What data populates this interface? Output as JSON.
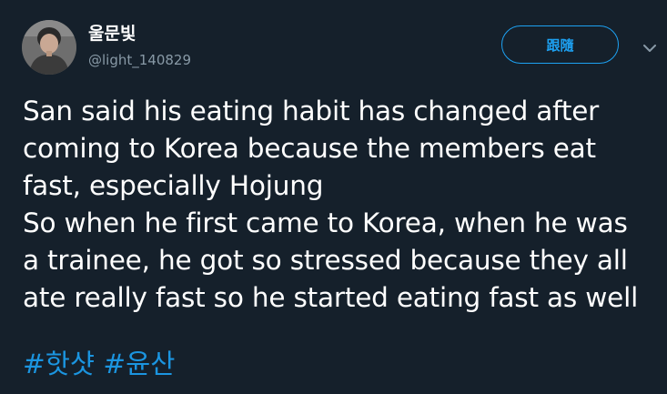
{
  "header": {
    "display_name": "울문빛",
    "handle": "@light_140829",
    "follow_label": "跟隨"
  },
  "tweet": {
    "lines": [
      "San said his eating habit has changed after",
      "coming to Korea because the members eat",
      "fast, especially Hojung",
      "So when he first came to Korea, when he was",
      "a trainee, he got so stressed because they all",
      "ate really fast so he started eating fast as well"
    ],
    "hashtags": [
      "#핫샷",
      "#윤산"
    ]
  },
  "icons": {
    "menu": "chevron-down-icon",
    "avatar": "user-photo"
  },
  "colors": {
    "background": "#15202b",
    "accent": "#1da1f2",
    "hashtag": "#1b95e0",
    "secondary_text": "#8899a6"
  }
}
